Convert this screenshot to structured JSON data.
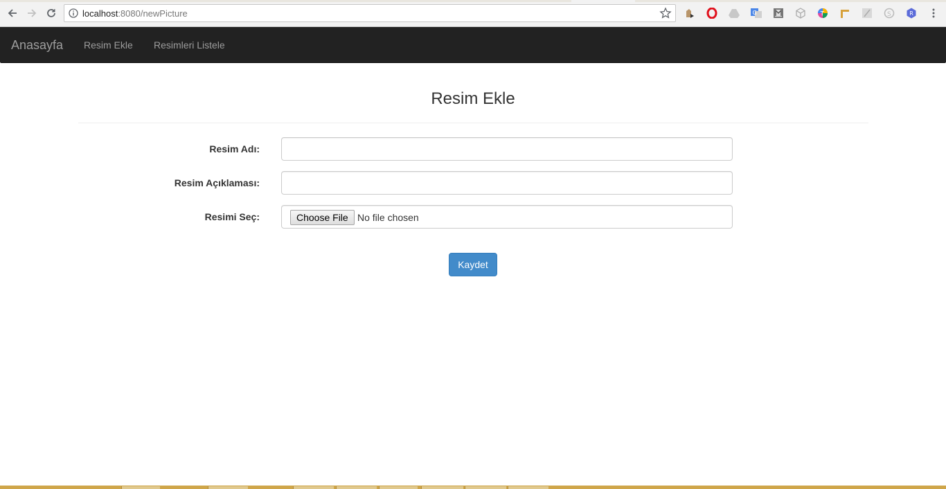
{
  "browser": {
    "url_host": "localhost",
    "url_rest": ":8080/newPicture",
    "nav_icons": [
      "back-icon",
      "forward-icon",
      "reload-icon"
    ],
    "extension_icons": [
      "download-helper-icon",
      "opera-icon",
      "drive-icon",
      "translate-icon",
      "extension-m-icon",
      "cube-icon",
      "colorful-t-icon",
      "pencil-ruler-icon",
      "pdf-icon",
      "skype-icon",
      "r-badge-icon"
    ],
    "menu_icon": "kebab-menu-icon"
  },
  "navbar": {
    "brand": "Anasayfa",
    "links": [
      "Resim Ekle",
      "Resimleri Listele"
    ],
    "background": "#222222",
    "text_color": "#9d9d9d"
  },
  "page": {
    "title": "Resim Ekle",
    "form": {
      "name_label": "Resim Adı:",
      "name_value": "",
      "description_label": "Resim Açıklaması:",
      "description_value": "",
      "file_label": "Resimi Seç:",
      "file_button": "Choose File",
      "file_status": "No file chosen",
      "submit": "Kaydet"
    },
    "accent": "#428bca"
  }
}
